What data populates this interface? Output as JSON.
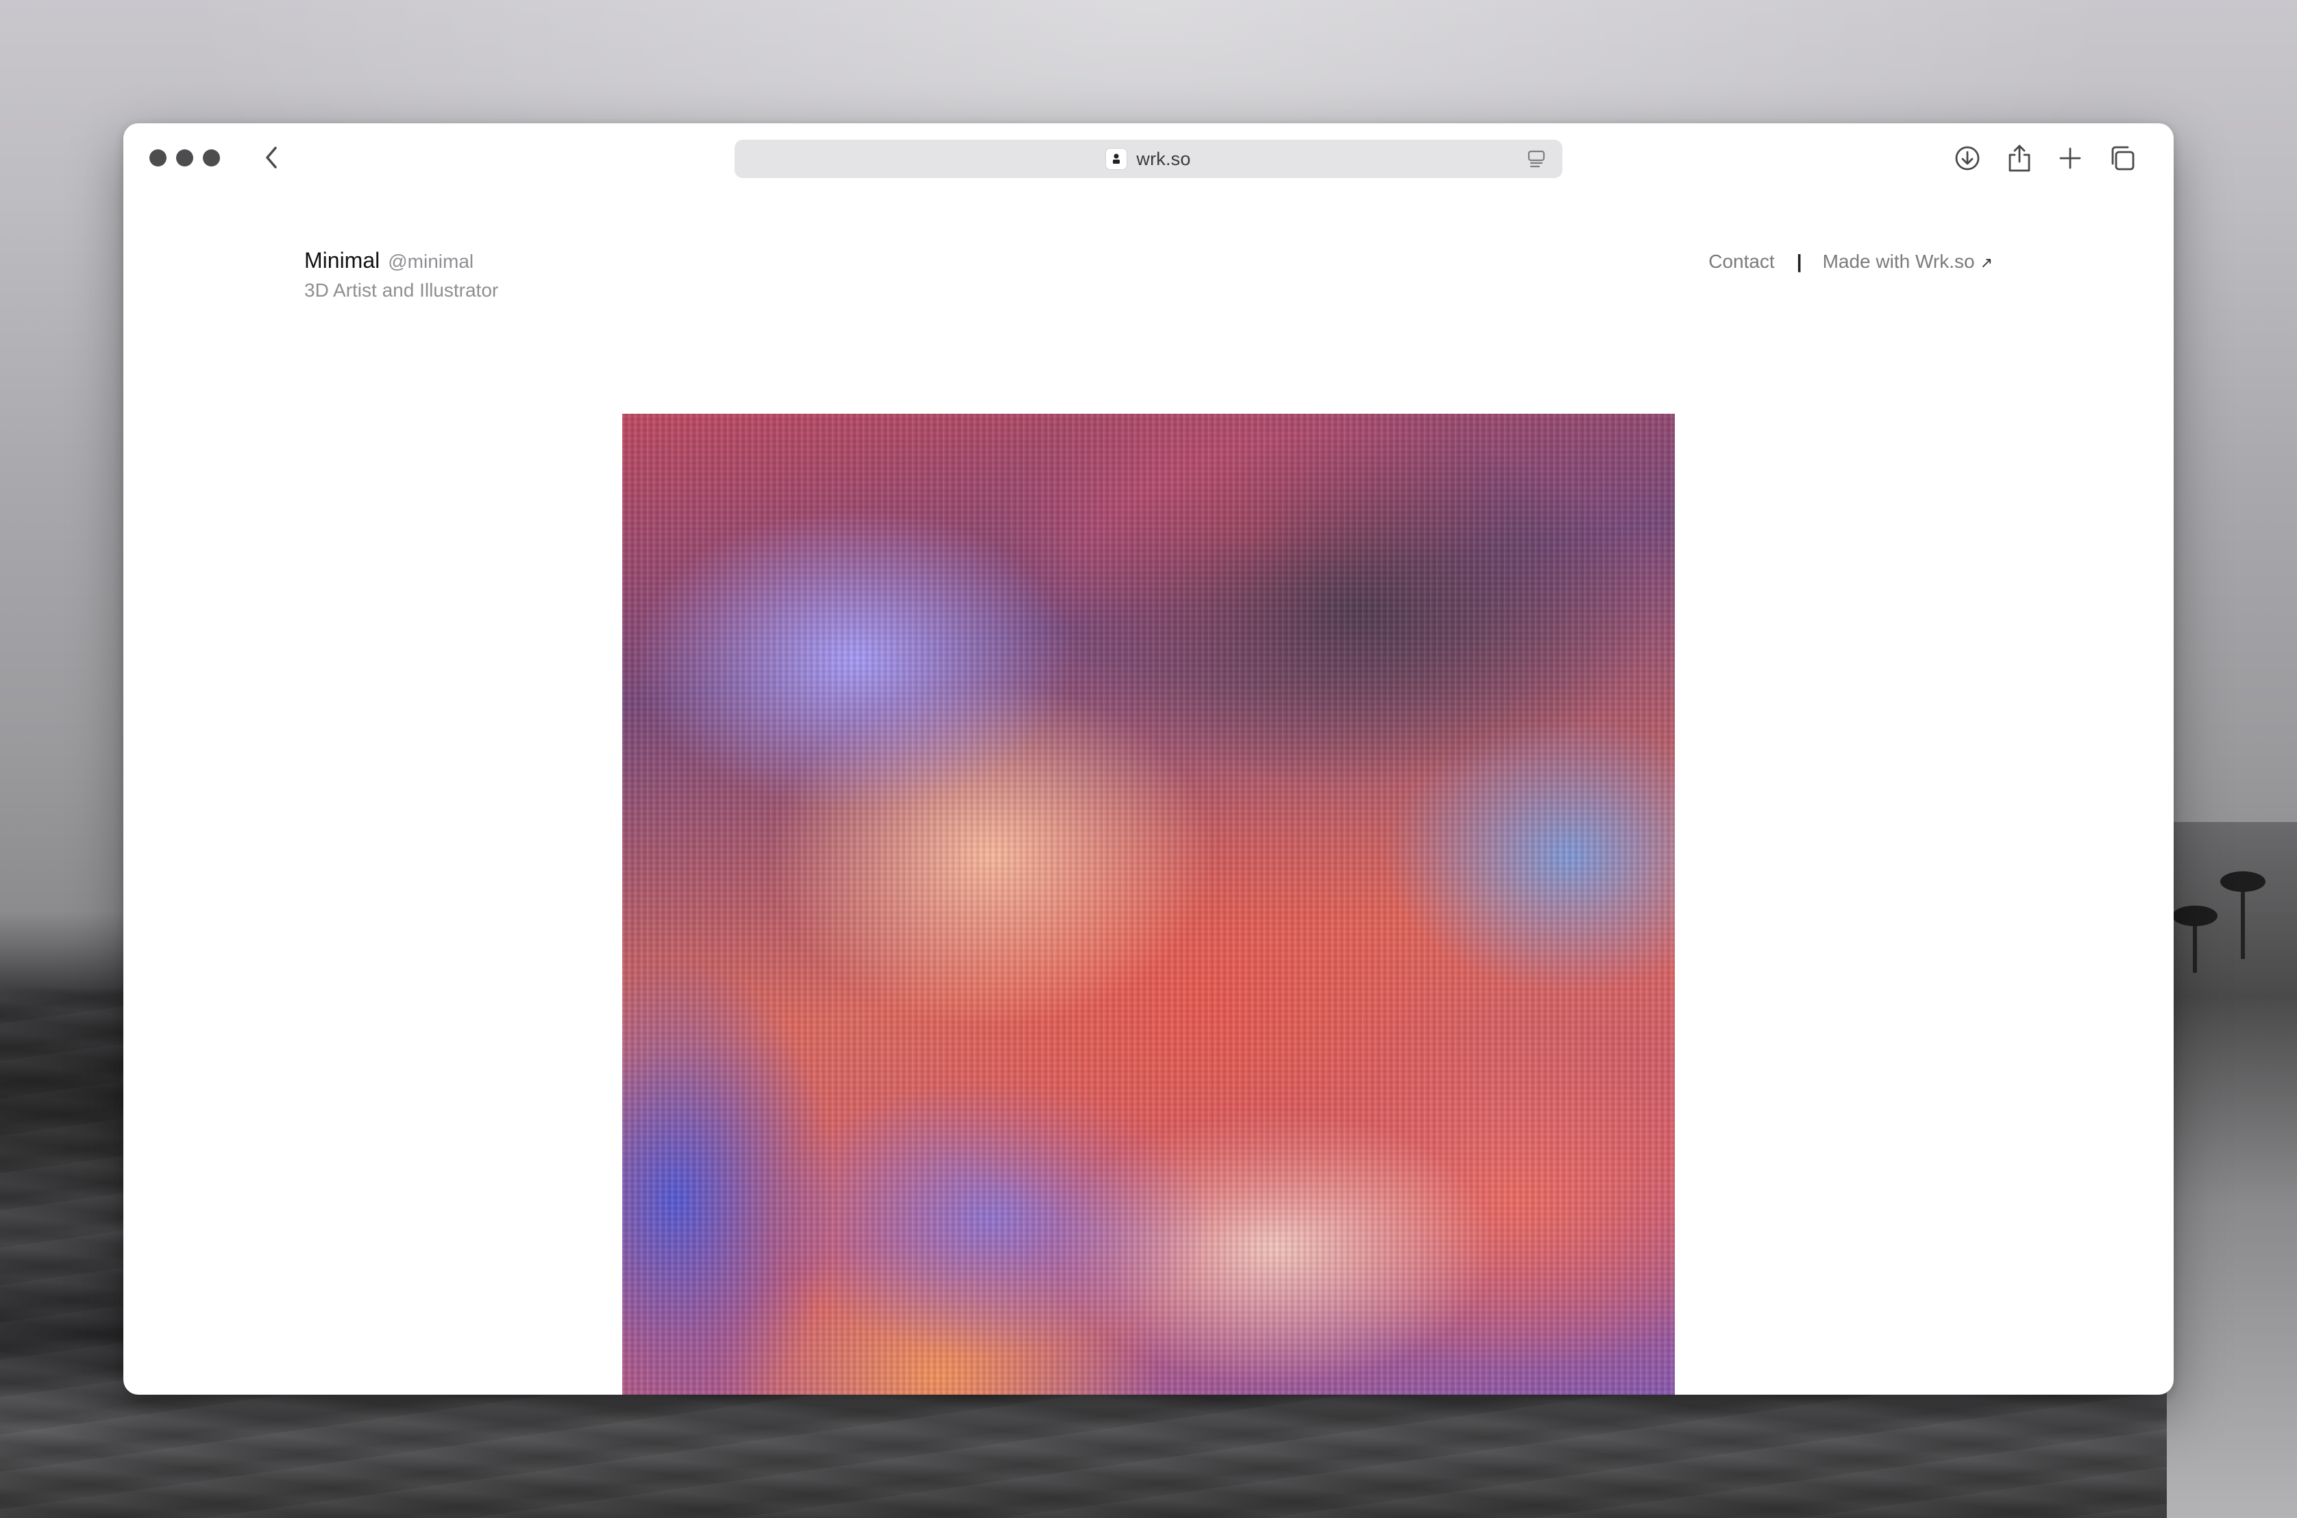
{
  "browser": {
    "url": "wrk.so",
    "icons": {
      "back": "chevron-left-icon",
      "reader": "reader-mode-icon",
      "download": "download-icon",
      "share": "share-icon",
      "new_tab": "plus-icon",
      "tabs": "tab-overview-icon"
    }
  },
  "site": {
    "name": "Minimal",
    "handle": "@minimal",
    "role": "3D Artist and Illustrator",
    "nav": {
      "contact": "Contact",
      "separator": "|",
      "made_with": "Made with Wrk.so",
      "made_with_arrow": "↗"
    }
  },
  "artwork": {
    "description_colors": [
      "#e85a55",
      "#f4a8a0",
      "#6a5ad8",
      "#3a3040"
    ]
  }
}
